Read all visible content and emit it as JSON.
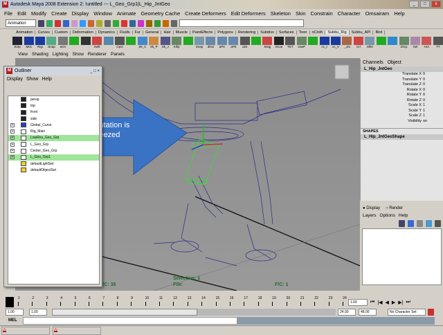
{
  "window": {
    "title": "Autodesk Maya 2008 Extension 2: !untitled   ---   L_Geo_Grp1|L_Hip_JntGeo"
  },
  "menu": [
    "File",
    "Edit",
    "Modify",
    "Create",
    "Display",
    "Window",
    "Animate",
    "Geometry Cache",
    "Create Deformers",
    "Edit Deformers",
    "Skeleton",
    "Skin",
    "Constrain",
    "Character",
    "Omsairam",
    "Help"
  ],
  "status": {
    "mode": "Animation"
  },
  "shelf_tabs": [
    "Animation",
    "Curves",
    "Custom",
    "Deformation",
    "Dynamics",
    "Fluids",
    "Fur",
    "General",
    "Hair",
    "Muscle",
    "PaintEffects",
    "Polygons",
    "Rendering",
    "Subdivs",
    "Surfaces",
    "Toon",
    "nCloth",
    "Subbu_Rig",
    "Subbu_API",
    "Bird"
  ],
  "active_shelf": "Subbu_Rig",
  "shelf_buttons": [
    "Ectp",
    "Mck",
    "Rigi",
    "Snap",
    "aGn",
    "",
    "",
    "Swft",
    "",
    "Cpct",
    "",
    "Sk_C",
    "Sk_P",
    "Sk_J",
    "Kifip",
    "",
    "Snap",
    "dfssl",
    "aPtt",
    "aPtt",
    "sZe",
    "",
    "Msqj",
    "Ocue",
    "TET",
    "sswP",
    "",
    "cc_t",
    "cc_V",
    "_Jnt",
    "Crl",
    "Slfel",
    "",
    "",
    "2Grp",
    "Sel",
    "HrA",
    "TT"
  ],
  "panel_menu": [
    "View",
    "Shading",
    "Lighting",
    "Show",
    "Renderer",
    "Panels"
  ],
  "viewport": {
    "callout": "Orientation is freezed",
    "hud": {
      "fc_left_label": "F/C:",
      "fc_left_value": "35",
      "selection_label": "Selection:",
      "selection_value": "1",
      "file_label": "File:",
      "fc_right_label": "F/C:",
      "fc_right_value": "1"
    },
    "accent": "#3a73c4"
  },
  "outliner": {
    "title": "Outliner",
    "menu": [
      "Display",
      "Show",
      "Help"
    ],
    "items": [
      {
        "label": "persp",
        "icon": "camera-icon",
        "expand": false,
        "selected": false
      },
      {
        "label": "top",
        "icon": "camera-icon",
        "expand": false,
        "selected": false
      },
      {
        "label": "front",
        "icon": "camera-icon",
        "expand": false,
        "selected": false
      },
      {
        "label": "side",
        "icon": "camera-icon",
        "expand": false,
        "selected": false
      },
      {
        "label": "Global_Curve",
        "icon": "curve-icon",
        "expand": true,
        "selected": false
      },
      {
        "label": "Rig_Main",
        "icon": "group-icon",
        "expand": true,
        "selected": false
      },
      {
        "label": "LowRes_Geo_Grp",
        "icon": "group-icon",
        "expand": true,
        "selected": true
      },
      {
        "label": "L_Geo_Grp",
        "icon": "group-icon",
        "expand": true,
        "selected": false
      },
      {
        "label": "Center_Geo_Grp",
        "icon": "group-icon",
        "expand": true,
        "selected": false
      },
      {
        "label": "L_Geo_Grp1",
        "icon": "group-icon",
        "expand": true,
        "selected": true
      },
      {
        "label": "defaultLightSet",
        "icon": "set-icon",
        "expand": false,
        "selected": false
      },
      {
        "label": "defaultObjectSet",
        "icon": "set-icon",
        "expand": false,
        "selected": false
      }
    ]
  },
  "channels": {
    "tabs": [
      "Channels",
      "Object"
    ],
    "object": "L_Hip_JntGeo",
    "attrs": [
      [
        "Translate X",
        "0"
      ],
      [
        "Translate Y",
        "0"
      ],
      [
        "Translate Z",
        "0"
      ],
      [
        "Rotate X",
        "0"
      ],
      [
        "Rotate Y",
        "0"
      ],
      [
        "Rotate Z",
        "0"
      ],
      [
        "Scale X",
        "1"
      ],
      [
        "Scale Y",
        "1"
      ],
      [
        "Scale Z",
        "1"
      ],
      [
        "Visibility",
        "on"
      ]
    ],
    "shapes_label": "SHAPES",
    "shape": "L_Hip_JntGeoShape"
  },
  "layers": {
    "display": "Display",
    "render": "Render",
    "menu": [
      "Layers",
      "Options",
      "Help"
    ]
  },
  "timeline": {
    "ticks": [
      "1",
      "2",
      "3",
      "4",
      "5",
      "6",
      "7",
      "8",
      "9",
      "10",
      "11",
      "12",
      "13",
      "14",
      "15",
      "16",
      "17",
      "18",
      "19",
      "20",
      "21",
      "22",
      "23",
      "24"
    ],
    "current": "1.00"
  },
  "range": {
    "start": "1.00",
    "start2": "1.00",
    "end": "24.00",
    "end2": "48.00",
    "character": "No Character Set"
  },
  "mel": {
    "label": "MEL"
  }
}
